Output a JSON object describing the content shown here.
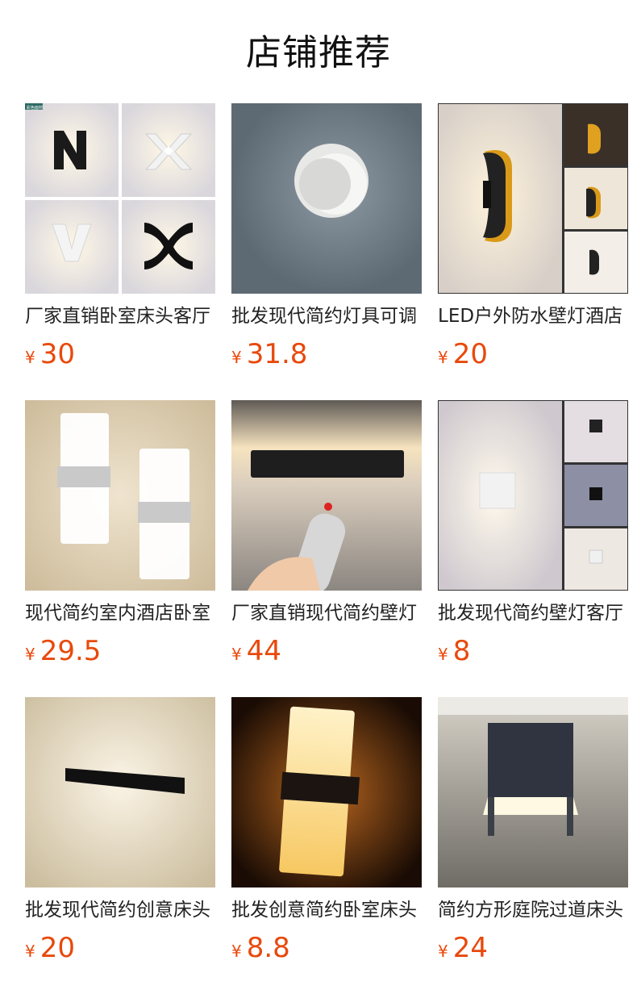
{
  "page": {
    "title": "店铺推荐"
  },
  "products": [
    {
      "name": "厂家直销卧室床头客厅",
      "currency": "¥",
      "price": "30"
    },
    {
      "name": "批发现代简约灯具可调",
      "currency": "¥",
      "price": "31.8"
    },
    {
      "name": "LED户外防水壁灯酒店",
      "currency": "¥",
      "price": "20"
    },
    {
      "name": "现代简约室内酒店卧室",
      "currency": "¥",
      "price": "29.5"
    },
    {
      "name": "厂家直销现代简约壁灯",
      "currency": "¥",
      "price": "44"
    },
    {
      "name": "批发现代简约壁灯客厅",
      "currency": "¥",
      "price": "8"
    },
    {
      "name": "批发现代简约创意床头",
      "currency": "¥",
      "price": "20"
    },
    {
      "name": "批发创意简约卧室床头",
      "currency": "¥",
      "price": "8.8"
    },
    {
      "name": "简约方形庭院过道床头",
      "currency": "¥",
      "price": "24"
    }
  ],
  "colors": {
    "price": "#e8490c",
    "title": "#111111"
  }
}
